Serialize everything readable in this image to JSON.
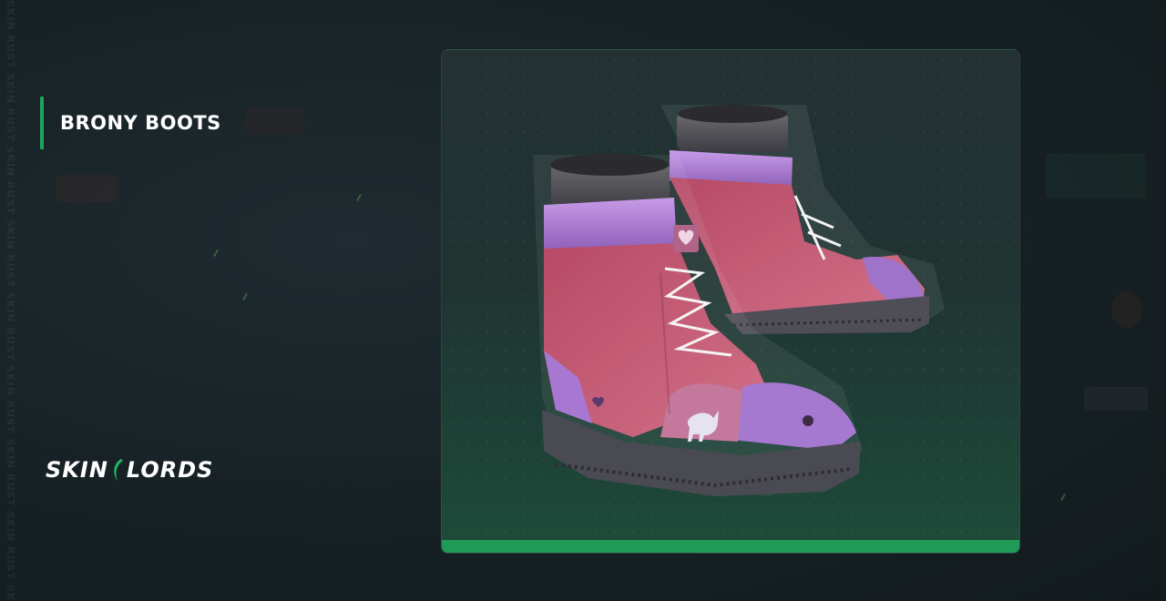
{
  "item": {
    "name": "BRONY BOOTS"
  },
  "brand": {
    "logo_left": "SKIN",
    "logo_right": "LORDS",
    "watermark": "SKIN RUST SKIN RUST SKIN RUST SKIN RUST SKIN RUST SKIN RUST SKIN RUST SKIN RUST SKIN RUST"
  },
  "colors": {
    "accent": "#1fa35c",
    "card_bar": "#1f9b57",
    "boot_pink": "#c95f78",
    "boot_purple": "#a779cf",
    "sole": "#4a4a52"
  },
  "icons": [
    "logo-mark-icon",
    "heart-icon",
    "unicorn-icon"
  ]
}
